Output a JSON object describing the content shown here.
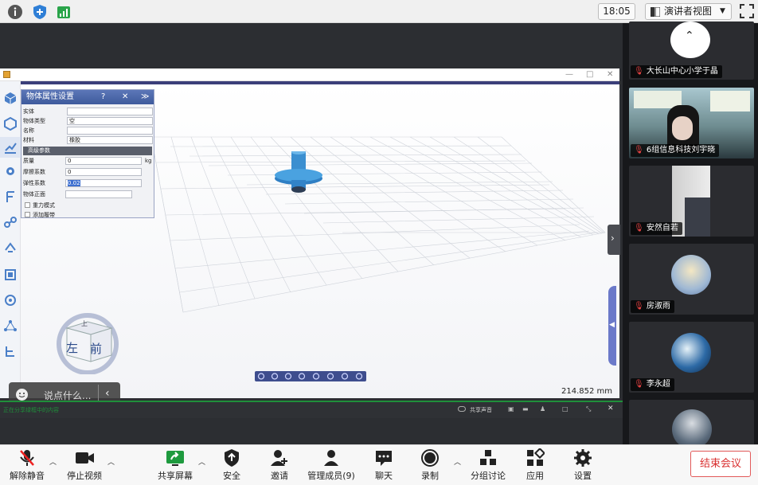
{
  "topbar": {
    "time": "18:05",
    "view_mode": "演讲者视图"
  },
  "app": {
    "panel_title": "物体属性设置",
    "help": "?",
    "close": "✕",
    "fields": [
      {
        "label": "实体",
        "value": ""
      },
      {
        "label": "物体类型",
        "value": "空"
      },
      {
        "label": "名称",
        "value": ""
      },
      {
        "label": "材料",
        "value": "橡胶"
      }
    ],
    "advanced_title": "高级参数",
    "params": [
      {
        "label": "质量",
        "value": "0",
        "unit": "kg"
      },
      {
        "label": "摩擦系数",
        "value": "0",
        "unit": ""
      },
      {
        "label": "弹性系数",
        "value": "0.02",
        "unit": ""
      },
      {
        "label": "物体正面",
        "value": "",
        "unit": ""
      }
    ],
    "checkboxes": [
      "重力模式",
      "添加履带"
    ],
    "cube_left": "左",
    "cube_front": "前",
    "cube_top": "上",
    "scale": "214.852 mm"
  },
  "chat": {
    "placeholder": "说点什么..."
  },
  "share_status": {
    "left": "正在分享绿框中的内容",
    "sound": "共享声音"
  },
  "participants": [
    {
      "name": "大长山中心小学于晶"
    },
    {
      "name": "6组信息科技刘宇晓"
    },
    {
      "name": "安然自若"
    },
    {
      "name": "房淑雨"
    },
    {
      "name": "李永超"
    }
  ],
  "toolbar": {
    "unmute": "解除静音",
    "stop_video": "停止视频",
    "share": "共享屏幕",
    "security": "安全",
    "invite": "邀请",
    "members": "管理成员(9)",
    "chat": "聊天",
    "record": "录制",
    "breakout": "分组讨论",
    "apps": "应用",
    "settings": "设置",
    "end": "结束会议"
  },
  "colors": {
    "accent_blue": "#2f7fd6",
    "end_red": "#d92f2f",
    "share_green": "#1f8f3a",
    "model_blue": "#3b8fd0"
  }
}
